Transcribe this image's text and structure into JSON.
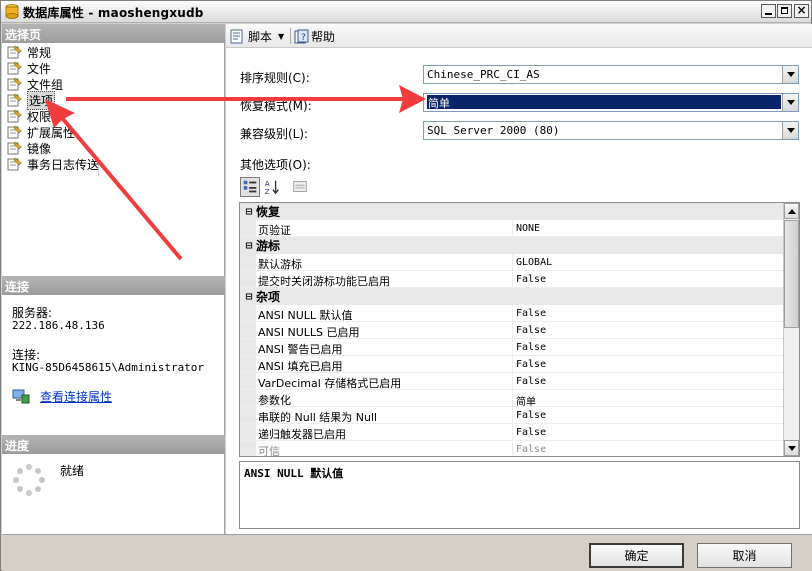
{
  "window": {
    "title": "数据库属性 - maoshengxudb"
  },
  "left_panel": {
    "pages_header": "选择页",
    "pages": [
      {
        "label": "常规",
        "selected": false
      },
      {
        "label": "文件",
        "selected": false
      },
      {
        "label": "文件组",
        "selected": false
      },
      {
        "label": "选项",
        "selected": true
      },
      {
        "label": "权限",
        "selected": false
      },
      {
        "label": "扩展属性",
        "selected": false
      },
      {
        "label": "镜像",
        "selected": false
      },
      {
        "label": "事务日志传送",
        "selected": false
      }
    ],
    "connection_header": "连接",
    "server_label": "服务器:",
    "server_value": "222.186.48.136",
    "connection_label": "连接:",
    "connection_value": "KING-85D6458615\\Administrator",
    "connection_link": "查看连接属性",
    "progress_header": "进度",
    "progress_status": "就绪"
  },
  "toolbar": {
    "script_label": "脚本",
    "help_label": "帮助"
  },
  "form": {
    "collation_label": "排序规则(C):",
    "collation_value": "Chinese_PRC_CI_AS",
    "recovery_label": "恢复模式(M):",
    "recovery_value": "简单",
    "compat_label": "兼容级别(L):",
    "compat_value": "SQL Server 2000 (80)",
    "other_label": "其他选项(O):"
  },
  "property_grid": {
    "categories": [
      {
        "name": "恢复",
        "rows": [
          {
            "name": "页验证",
            "value": "NONE",
            "dim": false
          }
        ]
      },
      {
        "name": "游标",
        "rows": [
          {
            "name": "默认游标",
            "value": "GLOBAL",
            "dim": false
          },
          {
            "name": "提交时关闭游标功能已启用",
            "value": "False",
            "dim": false
          }
        ]
      },
      {
        "name": "杂项",
        "rows": [
          {
            "name": "ANSI NULL 默认值",
            "value": "False",
            "dim": false
          },
          {
            "name": "ANSI NULLS 已启用",
            "value": "False",
            "dim": false
          },
          {
            "name": "ANSI 警告已启用",
            "value": "False",
            "dim": false
          },
          {
            "name": "ANSI 填充已启用",
            "value": "False",
            "dim": false
          },
          {
            "name": "VarDecimal 存储格式已启用",
            "value": "False",
            "dim": false
          },
          {
            "name": "参数化",
            "value": "简单",
            "dim": false
          },
          {
            "name": "串联的 Null 结果为 Null",
            "value": "False",
            "dim": false
          },
          {
            "name": "递归触发器已启用",
            "value": "False",
            "dim": false
          },
          {
            "name": "可信",
            "value": "False",
            "dim": true
          }
        ]
      }
    ],
    "description_title": "ANSI NULL 默认值"
  },
  "buttons": {
    "ok": "确定",
    "cancel": "取消"
  },
  "colors": {
    "selection": "#0a246a",
    "annotation_arrow": "#f03c3c",
    "link": "#0033cc"
  },
  "icons": {
    "title": "database-icon",
    "page": "page-wrench-icon",
    "script": "script-icon",
    "help": "help-book-icon",
    "connection": "connection-properties-icon",
    "progress": "spinner-icon"
  }
}
